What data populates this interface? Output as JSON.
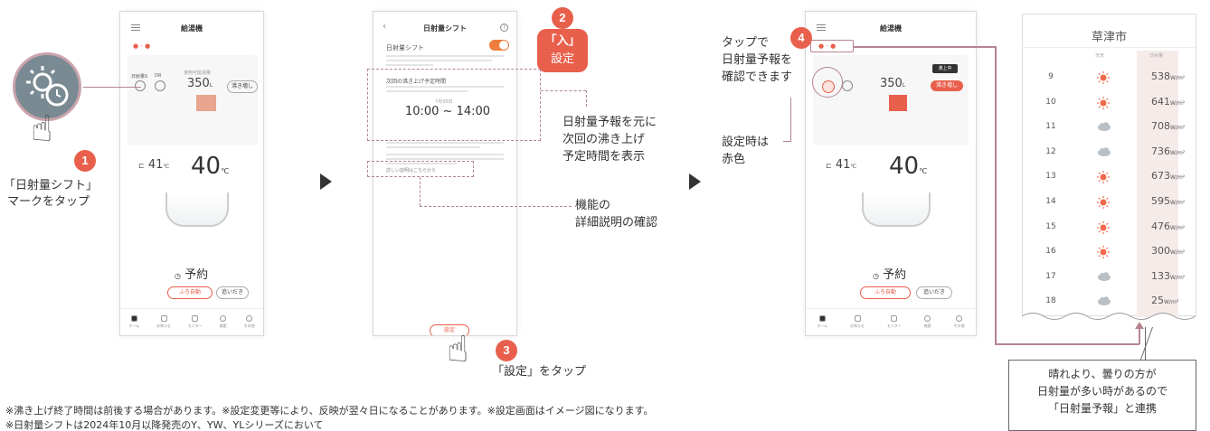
{
  "phone1": {
    "title": "給湯機",
    "temp_set": "40",
    "temp_set_unit": "℃",
    "temp_current": "41",
    "temp_current_unit": "℃",
    "remaining_label": "使用可能湯量",
    "remaining_value": "350",
    "remaining_unit": "L",
    "boil_button": "沸き増し",
    "icon_label_shift": "日射量S",
    "icon_label_dr": "DR",
    "reserve_label": "予約",
    "auto_button": "ふろ自動",
    "reheat_button": "追いだき",
    "nav": [
      "ホーム",
      "お知らせ",
      "モニター",
      "検索",
      "その他"
    ]
  },
  "phone2": {
    "title": "日射量シフト",
    "toggle_label": "日射量シフト",
    "section_title": "次回の沸き上げ予定時間",
    "date_label": "7月30日",
    "time_range": "10:00 ~ 14:00",
    "help_link": "詳しい説明はこちらから",
    "set_button": "設定"
  },
  "phone3": {
    "title": "給湯機",
    "temp_set": "40",
    "temp_set_unit": "℃",
    "temp_current": "41",
    "temp_current_unit": "℃",
    "remaining_value": "350",
    "remaining_unit": "L",
    "boil_button": "沸き増し",
    "status_badge": "沸上中",
    "reserve_label": "予約",
    "auto_button": "ふろ自動",
    "reheat_button": "追いだき",
    "nav": [
      "ホーム",
      "お知らせ",
      "モニター",
      "検索",
      "その他"
    ]
  },
  "annotations": {
    "step1_number": "1",
    "step1_text_line1": "「日射量シフト」",
    "step1_text_line2": "マークをタップ",
    "step2_number": "2",
    "step2_text_line1": "「入」",
    "step2_text_line2": "設定",
    "forecast_text_line1": "日射量予報を元に",
    "forecast_text_line2": "次回の沸き上げ",
    "forecast_text_line3": "予定時間を表示",
    "detail_text_line1": "機能の",
    "detail_text_line2": "詳細説明の確認",
    "step3_number": "3",
    "step3_text": "「設定」をタップ",
    "step4_number": "4",
    "step4_text_line1": "タップで",
    "step4_text_line2": "日射量予報を",
    "step4_text_line3": "確認できます",
    "red_text_line1": "設定時は",
    "red_text_line2": "赤色"
  },
  "weather": {
    "city": "草津市",
    "col_weather": "天気",
    "col_radiation": "日射量",
    "unit": "W/m²",
    "rows": [
      {
        "hour": "9",
        "icon": "sun-icon",
        "value": "538"
      },
      {
        "hour": "10",
        "icon": "sun-icon",
        "value": "641"
      },
      {
        "hour": "11",
        "icon": "cloud-icon",
        "value": "708"
      },
      {
        "hour": "12",
        "icon": "cloud-icon",
        "value": "736"
      },
      {
        "hour": "13",
        "icon": "sun-icon",
        "value": "673"
      },
      {
        "hour": "14",
        "icon": "sun-icon",
        "value": "595"
      },
      {
        "hour": "15",
        "icon": "sun-icon",
        "value": "476"
      },
      {
        "hour": "16",
        "icon": "sun-icon",
        "value": "300"
      },
      {
        "hour": "17",
        "icon": "cloud-icon",
        "value": "133"
      },
      {
        "hour": "18",
        "icon": "cloud-icon",
        "value": "25"
      }
    ]
  },
  "callout": {
    "line1": "晴れより、曇りの方が",
    "line2": "日射量が多い時があるので",
    "line3": "「日射量予報」と連携"
  },
  "notes": {
    "line1": "※沸き上げ終了時間は前後する場合があります。※設定変更等により、反映が翌々日になることがあります。※設定画面はイメージ図になります。",
    "line2": "※日射量シフトは2024年10月以降発売のY、YW、YLシリーズにおいて"
  },
  "colors": {
    "accent": "#e8604c",
    "connector": "#b58590",
    "toggle": "#ef7d3c"
  }
}
